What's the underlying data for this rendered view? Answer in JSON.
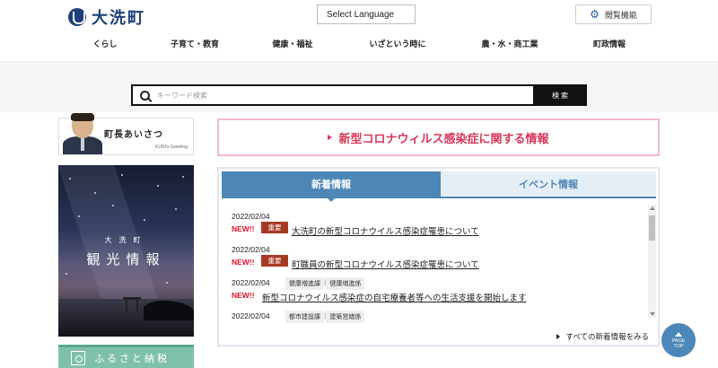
{
  "header": {
    "logo_text": "大洗町",
    "language_select": "Select Language",
    "accessibility_label": "閲覧機能"
  },
  "nav": [
    "くらし",
    "子育て・教育",
    "健康・福祉",
    "いざという時に",
    "農・水・商工業",
    "町政情報"
  ],
  "search": {
    "placeholder": "キーワード検索",
    "button": "検索"
  },
  "sidebar": {
    "greeting_title": "町長あいさつ",
    "greeting_sub": "KUNI's Greeting",
    "tourism_small": "大洗町",
    "tourism_big": "観光情報",
    "furusato": "ふるさと納税"
  },
  "covid_banner": "新型コロナウィルス感染症に関する情報",
  "tabs": {
    "news": "新着情報",
    "event": "イベント情報"
  },
  "news_items": [
    {
      "date": "2022/02/04",
      "new": "NEW!!",
      "important": "重要",
      "title": "大洗町の新型コロナウイルス感染症罹患について"
    },
    {
      "date": "2022/02/04",
      "new": "NEW!!",
      "important": "重要",
      "title": "町職員の新型コロナウイルス感染症罹患について"
    },
    {
      "date": "2022/02/04",
      "dept1": "健康増進課",
      "dept2": "健康増進係",
      "new": "NEW!!",
      "title": "新型コロナウイルス感染症の自宅療養者等への生活支援を開始します"
    },
    {
      "date": "2022/02/04",
      "dept1": "都市建設課",
      "dept2": "建築営繕係"
    }
  ],
  "all_news_link": "すべての新着情報をみる",
  "page_top": {
    "line1": "PAGE",
    "line2": "TOP"
  },
  "colors": {
    "brand": "#1d3f7c",
    "tab_blue": "#4c87b7",
    "covid_pink": "#d8365a",
    "new_red": "#e0112b",
    "important_brown": "#a53a24",
    "furusato_green": "#7fc1a8"
  }
}
